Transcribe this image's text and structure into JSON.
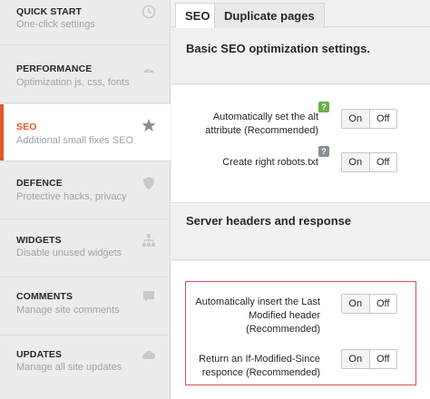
{
  "sidebar": {
    "items": [
      {
        "title": "QUICK START",
        "subtitle": "One-click settings",
        "icon": "clock-icon"
      },
      {
        "title": "PERFORMANCE",
        "subtitle": "Optimization js, css, fonts",
        "icon": "speedometer-icon"
      },
      {
        "title": "SEO",
        "subtitle": "Additional small fixes SEO",
        "icon": "star-icon"
      },
      {
        "title": "DEFENCE",
        "subtitle": "Protective hacks, privacy",
        "icon": "shield-icon"
      },
      {
        "title": "WIDGETS",
        "subtitle": "Disable unused widgets",
        "icon": "sitemap-icon"
      },
      {
        "title": "COMMENTS",
        "subtitle": "Manage site comments",
        "icon": "speech-bubble-icon"
      },
      {
        "title": "UPDATES",
        "subtitle": "Manage all site updates",
        "icon": "cloud-icon"
      }
    ],
    "active_index": 2,
    "accent_color": "#e5562a"
  },
  "tabs": [
    {
      "label": "SEO",
      "active": true
    },
    {
      "label": "Duplicate pages",
      "active": false
    }
  ],
  "sections": [
    {
      "heading": "Basic SEO optimization settings.",
      "rows": [
        {
          "label": "Automatically set the alt attribute (Recommended)",
          "help": "?",
          "on_label": "On",
          "off_label": "Off",
          "selected": "On"
        },
        {
          "label": "Create right robots.txt",
          "help": "?",
          "on_label": "On",
          "off_label": "Off",
          "selected": "On"
        }
      ]
    },
    {
      "heading": "Server headers and response",
      "rows": [
        {
          "label": "Automatically insert the Last Modified header (Recommended)",
          "on_label": "On",
          "off_label": "Off",
          "selected": "On"
        },
        {
          "label": "Return an If-Modified-Since responce (Recommended)",
          "on_label": "On",
          "off_label": "Off",
          "selected": "On"
        }
      ]
    }
  ],
  "colors": {
    "highlight_border": "#d9534f",
    "help_green": "#6ab04c",
    "help_gray": "#8a8f94"
  }
}
